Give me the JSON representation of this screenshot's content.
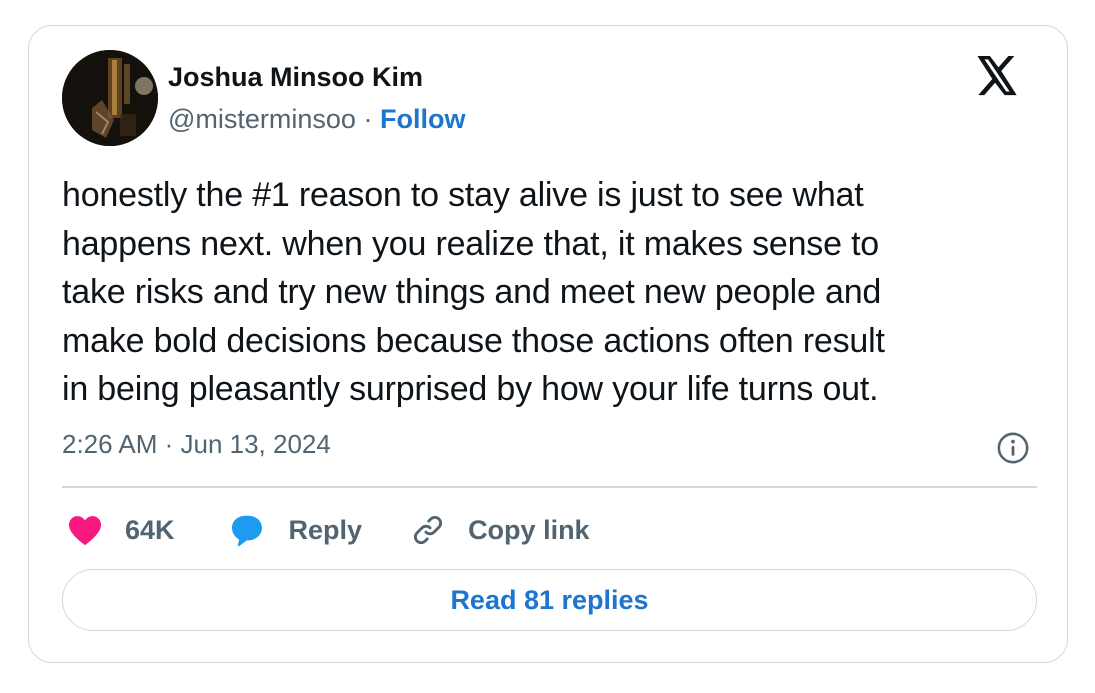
{
  "author": {
    "name": "Joshua Minsoo Kim",
    "handle": "@misterminsoo",
    "separator": "·",
    "follow_label": "Follow"
  },
  "tweet": {
    "text_lines": [
      "honestly the #1 reason to stay alive is just to see what",
      "happens next. when you realize that, it makes sense to",
      "take risks and try new things and meet new people and",
      "make bold decisions because those actions often result",
      "in being pleasantly surprised by how your life turns out."
    ],
    "timestamp": "2:26 AM · Jun 13, 2024"
  },
  "actions": {
    "like_count": "64K",
    "reply_label": "Reply",
    "copy_link_label": "Copy link"
  },
  "read_replies_label": "Read 81 replies",
  "icons": {
    "platform_logo": "x-logo-icon",
    "info": "info-icon",
    "like": "heart-icon",
    "reply": "speech-bubble-icon",
    "copy_link": "link-icon"
  },
  "colors": {
    "accent_blue": "#1d75d0",
    "like_pink": "#f91880",
    "reply_blue": "#1d9bf0",
    "text_primary": "#0f1419",
    "text_secondary": "#536471",
    "border": "#cfd9de"
  }
}
